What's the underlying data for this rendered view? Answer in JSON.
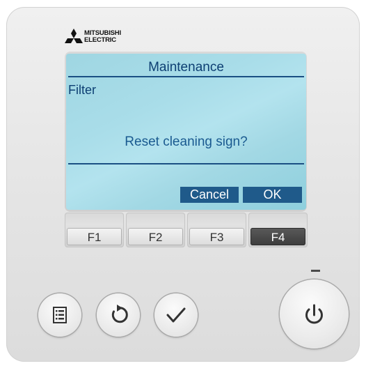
{
  "brand": {
    "name": "MITSUBISHI\nELECTRIC"
  },
  "screen": {
    "title": "Maintenance",
    "subtitle": "Filter",
    "message": "Reset cleaning sign?",
    "buttons": {
      "cancel": "Cancel",
      "ok": "OK"
    }
  },
  "function_keys": [
    {
      "label": "F1",
      "active": false
    },
    {
      "label": "F2",
      "active": false
    },
    {
      "label": "F3",
      "active": false
    },
    {
      "label": "F4",
      "active": true
    }
  ],
  "controls": {
    "menu_icon": "menu-list-icon",
    "return_icon": "return-arrow-icon",
    "confirm_icon": "checkmark-icon",
    "power_icon": "power-icon"
  },
  "colors": {
    "lcd_text": "#0d3f73",
    "lcd_button": "#1f5a8a",
    "lcd_background": "#a9dde9",
    "active_key": "#4a4a4a"
  }
}
